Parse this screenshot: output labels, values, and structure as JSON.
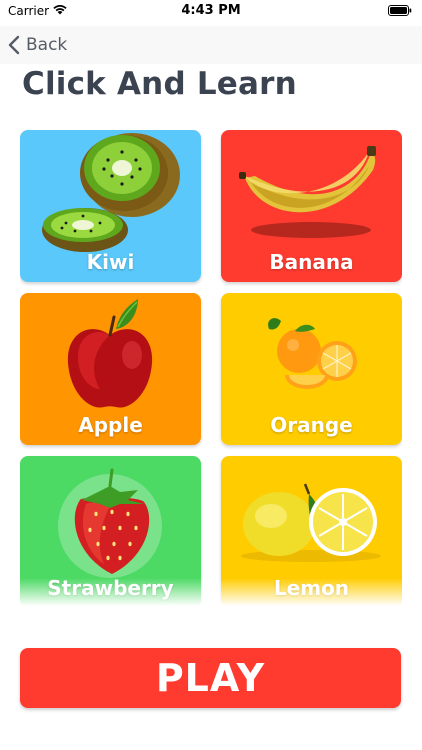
{
  "status_bar": {
    "carrier": "Carrier",
    "time": "4:43 PM"
  },
  "nav": {
    "back_label": "Back"
  },
  "page": {
    "title": "Click And Learn"
  },
  "fruits": [
    {
      "name": "Kiwi",
      "background": "#5ac8fa",
      "icon": "kiwi-icon"
    },
    {
      "name": "Banana",
      "background": "#ff3b30",
      "icon": "banana-icon"
    },
    {
      "name": "Apple",
      "background": "#ff9500",
      "icon": "apple-icon"
    },
    {
      "name": "Orange",
      "background": "#ffcc00",
      "icon": "orange-icon"
    },
    {
      "name": "Strawberry",
      "background": "#4cd964",
      "icon": "strawberry-icon"
    },
    {
      "name": "Lemon",
      "background": "#ffcc00",
      "icon": "lemon-icon"
    }
  ],
  "play_button": {
    "label": "PLAY",
    "color": "#ff3b30"
  }
}
